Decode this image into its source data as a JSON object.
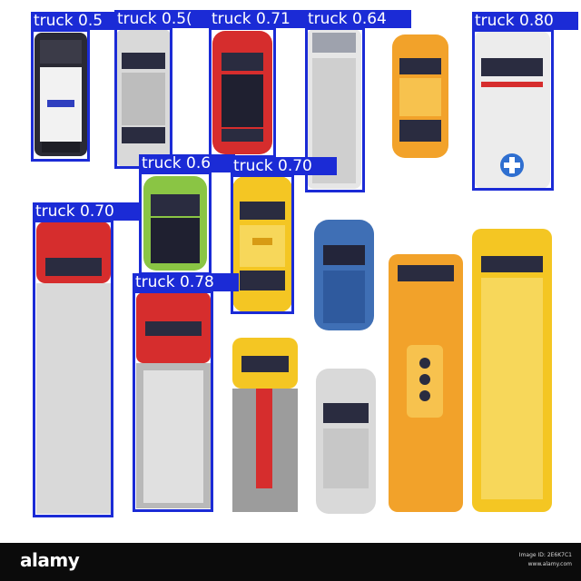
{
  "detections": [
    {
      "label": "truck 0.5"
    },
    {
      "label": "truck 0.5("
    },
    {
      "label": "truck 0.71"
    },
    {
      "label": "truck 0.64"
    },
    {
      "label": "truck 0.80"
    },
    {
      "label": "truck 0.6"
    },
    {
      "label": "truck 0.70"
    },
    {
      "label": "truck 0.70"
    },
    {
      "label": "truck 0.78"
    }
  ],
  "watermark": {
    "brand": "alamy",
    "image_id": "Image ID: 2E6K7C1",
    "url": "www.alamy.com"
  },
  "colors": {
    "box": "#1b2bd6",
    "red": "#d92d2d",
    "yellow": "#f4c623",
    "orange": "#f2a22a",
    "green": "#8ac544",
    "blue": "#3f6fb5",
    "gray": "#d6d6d6",
    "dark": "#23253a"
  }
}
